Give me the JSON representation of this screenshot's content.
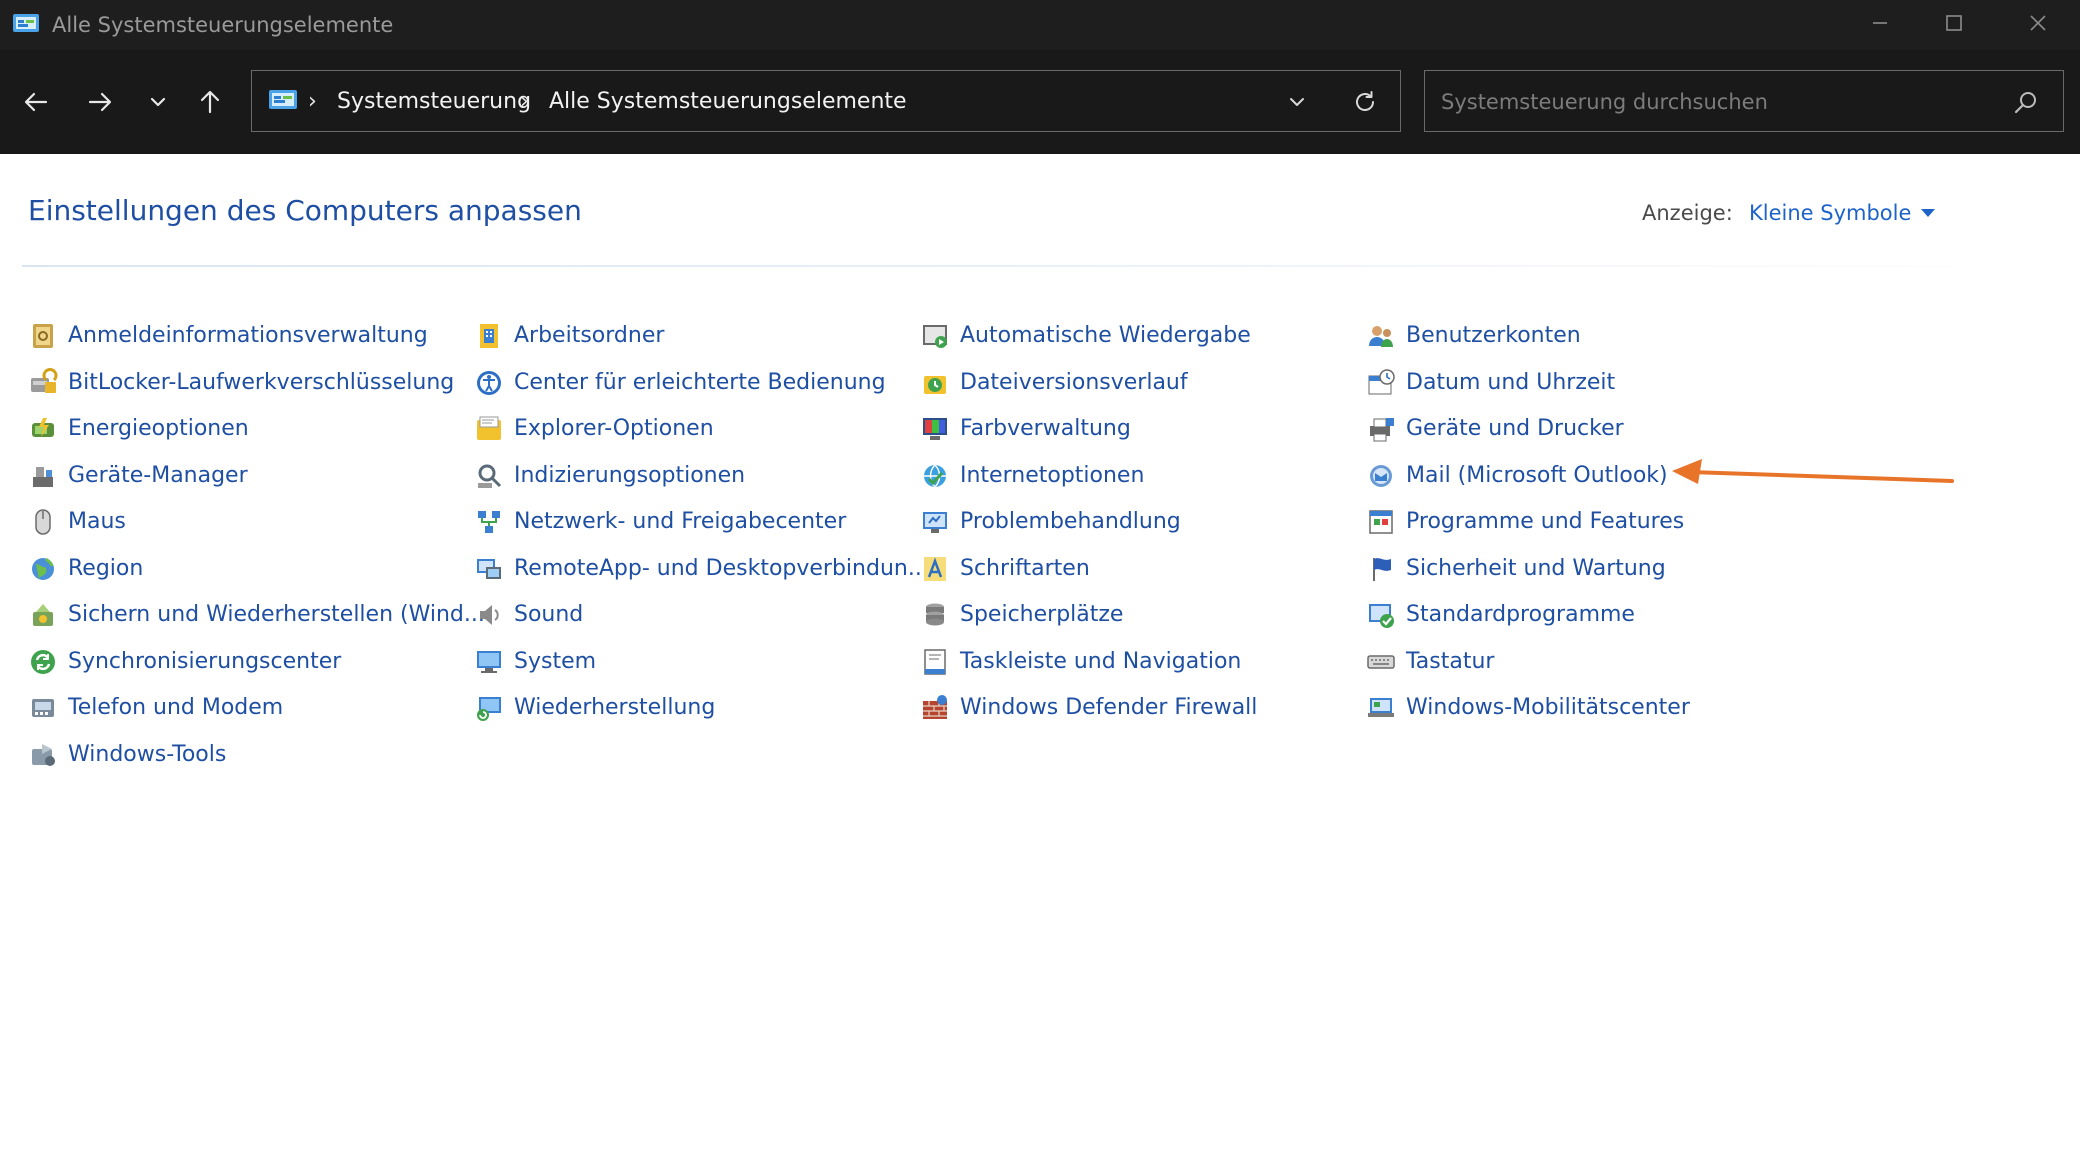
{
  "window": {
    "title": "Alle Systemsteuerungselemente",
    "controls": [
      "minimize",
      "maximize",
      "close"
    ]
  },
  "navigation": {
    "breadcrumb": [
      "Systemsteuerung",
      "Alle Systemsteuerungselemente"
    ],
    "search": {
      "placeholder": "Systemsteuerung durchsuchen",
      "value": ""
    }
  },
  "header": {
    "title": "Einstellungen des Computers anpassen",
    "view_label": "Anzeige:",
    "view_value": "Kleine Symbole"
  },
  "items": [
    [
      "Anmeldeinformationsverwaltung",
      "BitLocker-Laufwerkverschlüsselung",
      "Energieoptionen",
      "Geräte-Manager",
      "Maus",
      "Region",
      "Sichern und Wiederherstellen (Wind...",
      "Synchronisierungscenter",
      "Telefon und Modem",
      "Windows-Tools"
    ],
    [
      "Arbeitsordner",
      "Center für erleichterte Bedienung",
      "Explorer-Optionen",
      "Indizierungsoptionen",
      "Netzwerk- und Freigabecenter",
      "RemoteApp- und Desktopverbindun...",
      "Sound",
      "System",
      "Wiederherstellung"
    ],
    [
      "Automatische Wiedergabe",
      "Dateiversionsverlauf",
      "Farbverwaltung",
      "Internetoptionen",
      "Problembehandlung",
      "Schriftarten",
      "Speicherplätze",
      "Taskleiste und Navigation",
      "Windows Defender Firewall"
    ],
    [
      "Benutzerkonten",
      "Datum und Uhrzeit",
      "Geräte und Drucker",
      "Mail (Microsoft Outlook)",
      "Programme und Features",
      "Sicherheit und Wartung",
      "Standardprogramme",
      "Tastatur",
      "Windows-Mobilitätscenter"
    ]
  ],
  "icons": [
    [
      "credential-manager-icon",
      "bitlocker-icon",
      "power-options-icon",
      "device-manager-icon",
      "mouse-icon",
      "region-icon",
      "backup-restore-icon",
      "sync-center-icon",
      "phone-modem-icon",
      "windows-tools-icon"
    ],
    [
      "work-folders-icon",
      "ease-of-access-icon",
      "explorer-options-icon",
      "indexing-options-icon",
      "network-sharing-icon",
      "remoteapp-icon",
      "sound-icon",
      "system-icon",
      "recovery-icon"
    ],
    [
      "autoplay-icon",
      "file-history-icon",
      "color-management-icon",
      "internet-options-icon",
      "troubleshooting-icon",
      "fonts-icon",
      "storage-spaces-icon",
      "taskbar-navigation-icon",
      "firewall-icon"
    ],
    [
      "user-accounts-icon",
      "date-time-icon",
      "devices-printers-icon",
      "mail-icon",
      "programs-features-icon",
      "security-maintenance-icon",
      "default-programs-icon",
      "keyboard-icon",
      "mobility-center-icon"
    ]
  ],
  "colors": {
    "titlebar": "#1e1e1e",
    "navbar": "#191919",
    "link": "#1e4fa3",
    "accent": "#1e64c8",
    "annotation_arrow": "#e8742a"
  },
  "annotation": {
    "type": "arrow",
    "points_to": "Mail (Microsoft Outlook)"
  }
}
